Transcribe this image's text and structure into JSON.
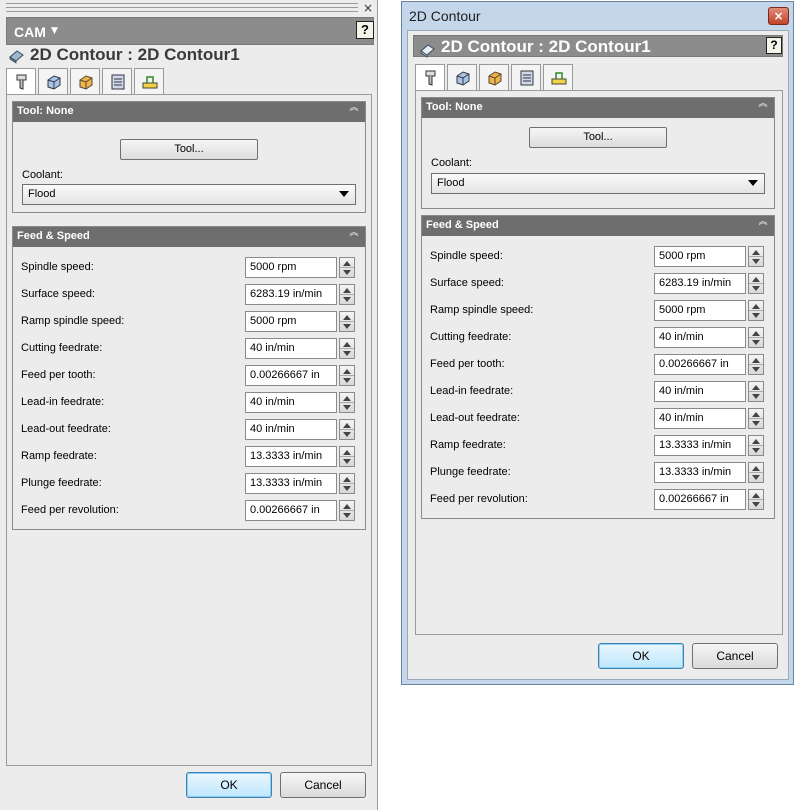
{
  "left_panel": {
    "cam_label": "CAM",
    "close_glyph": "×",
    "help_label": "?",
    "title": "2D Contour : 2D Contour1",
    "tool_group": {
      "title": "Tool: None",
      "tool_button": "Tool...",
      "coolant_label": "Coolant:",
      "coolant_value": "Flood"
    },
    "feed_group": {
      "title": "Feed & Speed",
      "rows": [
        {
          "label": "Spindle speed:",
          "value": "5000 rpm"
        },
        {
          "label": "Surface speed:",
          "value": "6283.19 in/min"
        },
        {
          "label": "Ramp spindle speed:",
          "value": "5000 rpm"
        },
        {
          "label": "Cutting feedrate:",
          "value": "40 in/min"
        },
        {
          "label": "Feed per tooth:",
          "value": "0.00266667 in"
        },
        {
          "label": "Lead-in feedrate:",
          "value": "40 in/min"
        },
        {
          "label": "Lead-out feedrate:",
          "value": "40 in/min"
        },
        {
          "label": "Ramp feedrate:",
          "value": "13.3333 in/min"
        },
        {
          "label": "Plunge feedrate:",
          "value": "13.3333 in/min"
        },
        {
          "label": "Feed per revolution:",
          "value": "0.00266667 in"
        }
      ]
    },
    "ok_label": "OK",
    "cancel_label": "Cancel"
  },
  "right_dialog": {
    "window_title": "2D Contour",
    "close_glyph": "×",
    "help_label": "?",
    "title": "2D Contour : 2D Contour1",
    "tool_group": {
      "title": "Tool: None",
      "tool_button": "Tool...",
      "coolant_label": "Coolant:",
      "coolant_value": "Flood"
    },
    "feed_group": {
      "title": "Feed & Speed",
      "rows": [
        {
          "label": "Spindle speed:",
          "value": "5000 rpm"
        },
        {
          "label": "Surface speed:",
          "value": "6283.19 in/min"
        },
        {
          "label": "Ramp spindle speed:",
          "value": "5000 rpm"
        },
        {
          "label": "Cutting feedrate:",
          "value": "40 in/min"
        },
        {
          "label": "Feed per tooth:",
          "value": "0.00266667 in"
        },
        {
          "label": "Lead-in feedrate:",
          "value": "40 in/min"
        },
        {
          "label": "Lead-out feedrate:",
          "value": "40 in/min"
        },
        {
          "label": "Ramp feedrate:",
          "value": "13.3333 in/min"
        },
        {
          "label": "Plunge feedrate:",
          "value": "13.3333 in/min"
        },
        {
          "label": "Feed per revolution:",
          "value": "0.00266667 in"
        }
      ]
    },
    "ok_label": "OK",
    "cancel_label": "Cancel"
  },
  "tabs": [
    {
      "icon": "tool-icon"
    },
    {
      "icon": "geometry-icon"
    },
    {
      "icon": "heights-icon"
    },
    {
      "icon": "passes-icon"
    },
    {
      "icon": "linking-icon"
    }
  ],
  "colors": {
    "group_header": "#6e6e6e",
    "window_frame": "#c4d6ea",
    "default_button": "#bee6fd"
  }
}
